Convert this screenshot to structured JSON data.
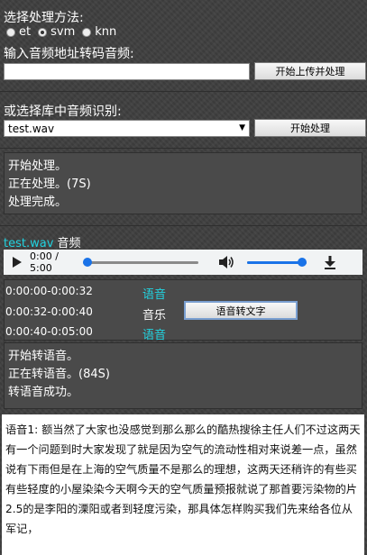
{
  "method": {
    "title": "选择处理方法:",
    "options": [
      {
        "label": "et",
        "selected": false
      },
      {
        "label": "svm",
        "selected": true
      },
      {
        "label": "knn",
        "selected": false
      }
    ]
  },
  "upload": {
    "title": "输入音频地址转码音频:",
    "input_value": "",
    "button": "开始上传并处理"
  },
  "library": {
    "title": "或选择库中音频识别:",
    "selected": "test.wav",
    "button": "开始处理"
  },
  "process_log": [
    "开始处理。",
    "正在处理。(7S)",
    "处理完成。"
  ],
  "audio": {
    "filename": "test.wav",
    "suffix": " 音频",
    "time": "0:00 / 5:00",
    "progress": 0.0,
    "volume": 1.0
  },
  "segments": [
    {
      "range": "0:00:00-0:00:32",
      "type": "语音",
      "highlight": true
    },
    {
      "range": "0:00:32-0:00:40",
      "type": "音乐",
      "highlight": false
    },
    {
      "range": "0:00:40-0:05:00",
      "type": "语音",
      "highlight": true
    }
  ],
  "convert_button": "语音转文字",
  "speech_log": [
    "开始转语音。",
    "正在转语音。(84S)",
    "转语音成功。"
  ],
  "transcript": "语音1: 额当然了大家也没感觉到那么那么的酷热搜徐主任人们不过这两天有一个问题到时大家发现了就是因为空气的流动性相对来说差一点，虽然说有下雨但是在上海的空气质量不是那么的理想，这两天还稍许的有些买有些轻度的小屋染染今天啊今天的空气质量预报就说了那首要污染物的片2.5的是李阳的溧阳或者到轻度污染，那具体怎样购买我们先来给各位从军记，"
}
